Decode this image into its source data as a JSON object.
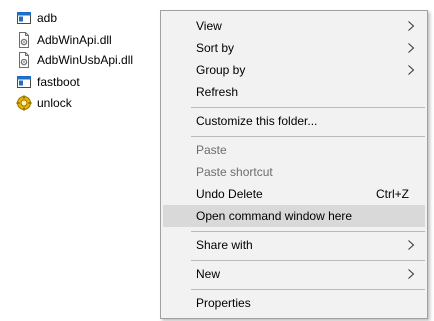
{
  "files": [
    {
      "name": "adb",
      "icon": "application-icon"
    },
    {
      "name": "AdbWinApi.dll",
      "icon": "dll-file-icon"
    },
    {
      "name": "AdbWinUsbApi.dll",
      "icon": "dll-file-icon"
    },
    {
      "name": "fastboot",
      "icon": "application-icon"
    },
    {
      "name": "unlock",
      "icon": "gear-script-icon"
    }
  ],
  "menu": {
    "view": {
      "label": "View",
      "submenu": true
    },
    "sort_by": {
      "label": "Sort by",
      "submenu": true
    },
    "group_by": {
      "label": "Group by",
      "submenu": true
    },
    "refresh": {
      "label": "Refresh"
    },
    "customize": {
      "label": "Customize this folder..."
    },
    "paste": {
      "label": "Paste",
      "enabled": false
    },
    "paste_shortcut": {
      "label": "Paste shortcut",
      "enabled": false
    },
    "undo_delete": {
      "label": "Undo Delete",
      "shortcut": "Ctrl+Z"
    },
    "open_cmd": {
      "label": "Open command window here",
      "highlighted": true
    },
    "share_with": {
      "label": "Share with",
      "submenu": true
    },
    "new": {
      "label": "New",
      "submenu": true
    },
    "properties": {
      "label": "Properties"
    }
  },
  "colors": {
    "menu_bg": "#f2f2f2",
    "highlight": "#d9d9d9",
    "disabled_text": "#6d6d6d",
    "separator": "#b9b9b9",
    "app_icon_blue": "#1f6fc5"
  }
}
